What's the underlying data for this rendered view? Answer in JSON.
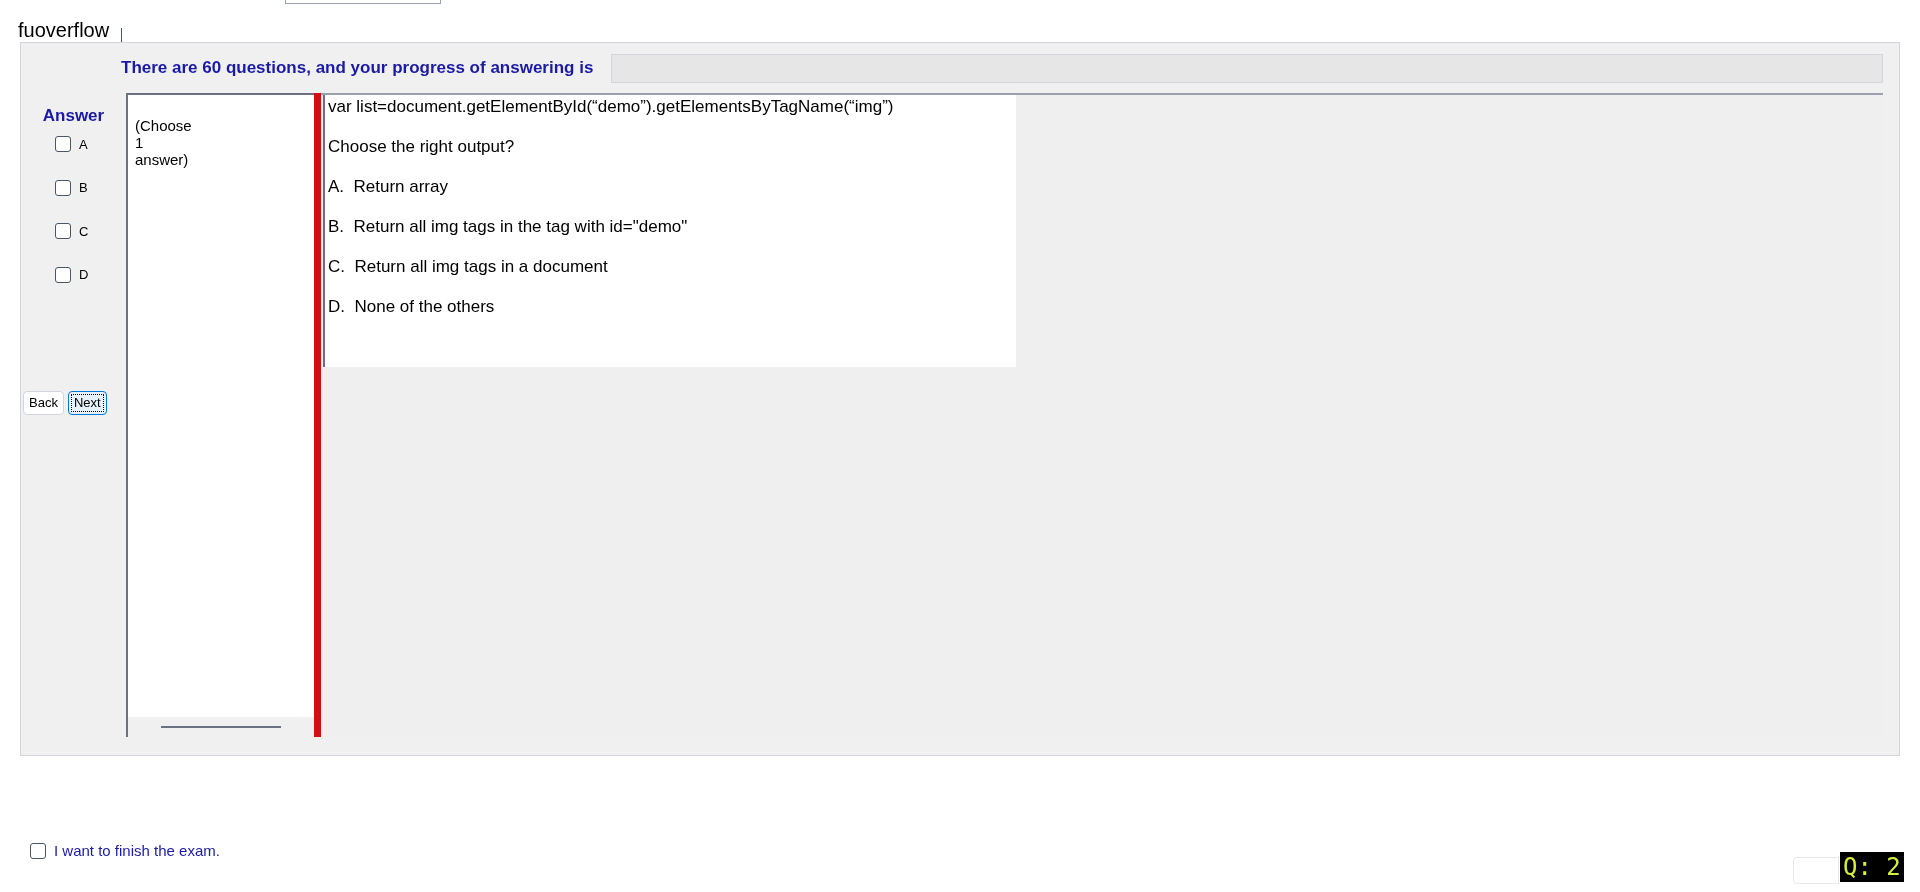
{
  "header": {
    "title": "fuoverflow"
  },
  "progress": {
    "label": "There are 60 questions, and your progress of answering is",
    "level": 0
  },
  "answer": {
    "title": "Answer",
    "options": [
      {
        "label": "A",
        "checked": false
      },
      {
        "label": "B",
        "checked": false
      },
      {
        "label": "C",
        "checked": false
      },
      {
        "label": "D",
        "checked": false
      }
    ]
  },
  "navigation": [
    {
      "label": "Back",
      "focused": false
    },
    {
      "label": "Next",
      "focused": true
    }
  ],
  "instruction": "(Choose\n1\nanswer)",
  "question": {
    "lines": [
      "var list=document.getElementById(“demo”).getElementsByTagName(“img”)",
      "Choose the right output?",
      "A.  Return array",
      "B.  Return all img tags in the tag with id=\"demo\"",
      "C.  Return all img tags in a document",
      "D.  None of the others"
    ]
  },
  "finish": {
    "label": "I want to finish the exam.",
    "checked": false
  },
  "question_badge": "Q: 2"
}
